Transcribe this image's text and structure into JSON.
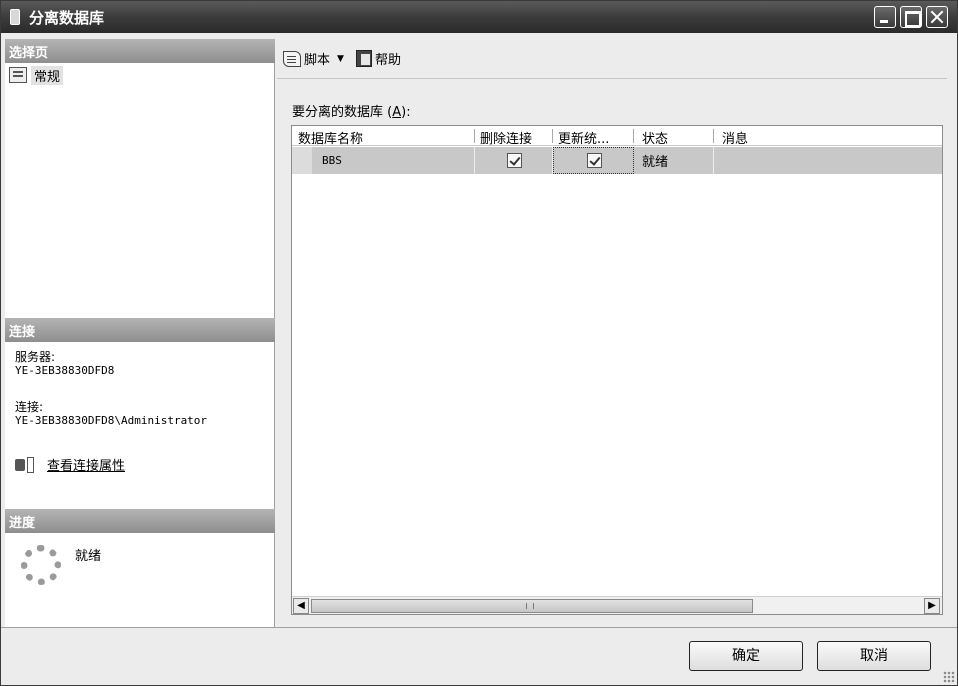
{
  "window": {
    "title": "分离数据库"
  },
  "left": {
    "select_page_header": "选择页",
    "nav_items": [
      {
        "label": "常规",
        "icon": "general-page-icon"
      }
    ],
    "connection_header": "连接",
    "server_label": "服务器:",
    "server_value": "YE-3EB38830DFD8",
    "connection_label": "连接:",
    "connection_value": "YE-3EB38830DFD8\\Administrator",
    "view_properties_link": "查看连接属性",
    "progress_header": "进度",
    "progress_status": "就绪"
  },
  "toolbar": {
    "script_label": "脚本",
    "help_label": "帮助"
  },
  "grid": {
    "label": "要分离的数据库",
    "label_accel": "A",
    "columns": [
      "数据库名称",
      "删除连接",
      "更新统...",
      "状态",
      "消息"
    ],
    "rows": [
      {
        "name": "BBS",
        "drop_connections": true,
        "update_statistics": true,
        "status": "就绪",
        "message": ""
      }
    ]
  },
  "footer": {
    "ok_label": "确定",
    "cancel_label": "取消"
  }
}
